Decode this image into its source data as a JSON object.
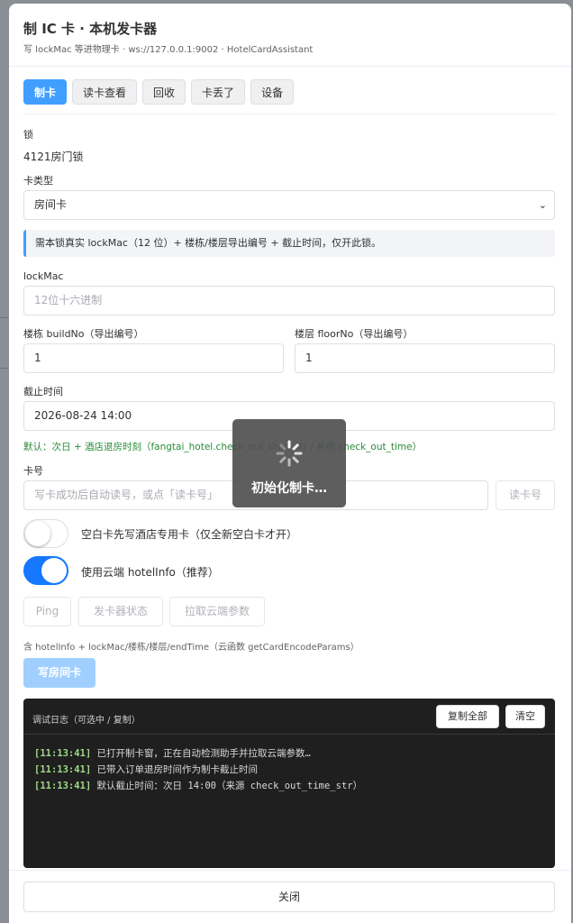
{
  "dialog": {
    "title": "制 IC 卡 · 本机发卡器",
    "subtitle": "写 lockMac 等进物理卡 · ws://127.0.0.1:9002 · HotelCardAssistant"
  },
  "tabs": [
    {
      "label": "制卡",
      "active": true
    },
    {
      "label": "读卡查看",
      "active": false
    },
    {
      "label": "回收",
      "active": false
    },
    {
      "label": "卡丢了",
      "active": false
    },
    {
      "label": "设备",
      "active": false
    }
  ],
  "form": {
    "lock_label": "锁",
    "lock_value": "4121房门锁",
    "card_type_label": "卡类型",
    "card_type_value": "房间卡",
    "info": "需本锁真实 lockMac（12 位）+ 楼栋/楼层导出编号 + 截止时间，仅开此锁。",
    "lockmac_label": "lockMac",
    "lockmac_placeholder": "12位十六进制",
    "build_label": "楼栋 buildNo（导出编号）",
    "build_value": "1",
    "floor_label": "楼层 floorNo（导出编号）",
    "floor_value": "1",
    "deadline_label": "截止时间",
    "deadline_value": "2026-08-24 14:00",
    "deadline_hint": "默认：次日 + 酒店退房时刻（fangtai_hotel.check_out_time_str / 系统 check_out_time）",
    "card_no_label": "卡号",
    "card_no_placeholder": "写卡成功后自动读号，或点「读卡号」",
    "read_card_button": "读卡号",
    "toggle_blank_label": "空白卡先写酒店专用卡（仅全新空白卡才开）",
    "toggle_cloud_label": "使用云端 hotelInfo（推荐）",
    "ping_button": "Ping",
    "status_button": "发卡器状态",
    "fetch_button": "拉取云端参数",
    "params_note": "含 hotelInfo + lockMac/楼栋/楼层/endTime（云函数 getCardEncodeParams）",
    "write_button": "写房间卡"
  },
  "log": {
    "title": "调试日志（可选中 / 复制）",
    "copy_all": "复制全部",
    "clear": "清空",
    "lines": [
      {
        "time": "[11:13:41]",
        "text": "已打开制卡窗，正在自动检测助手并拉取云端参数…"
      },
      {
        "time": "[11:13:41]",
        "text": "已带入订单退房时间作为制卡截止时间"
      },
      {
        "time": "[11:13:41]",
        "text": "默认截止时间：次日 14:00（来源 check_out_time_str）"
      }
    ]
  },
  "footer": {
    "close": "关闭"
  },
  "loading": {
    "text": "初始化制卡…"
  }
}
